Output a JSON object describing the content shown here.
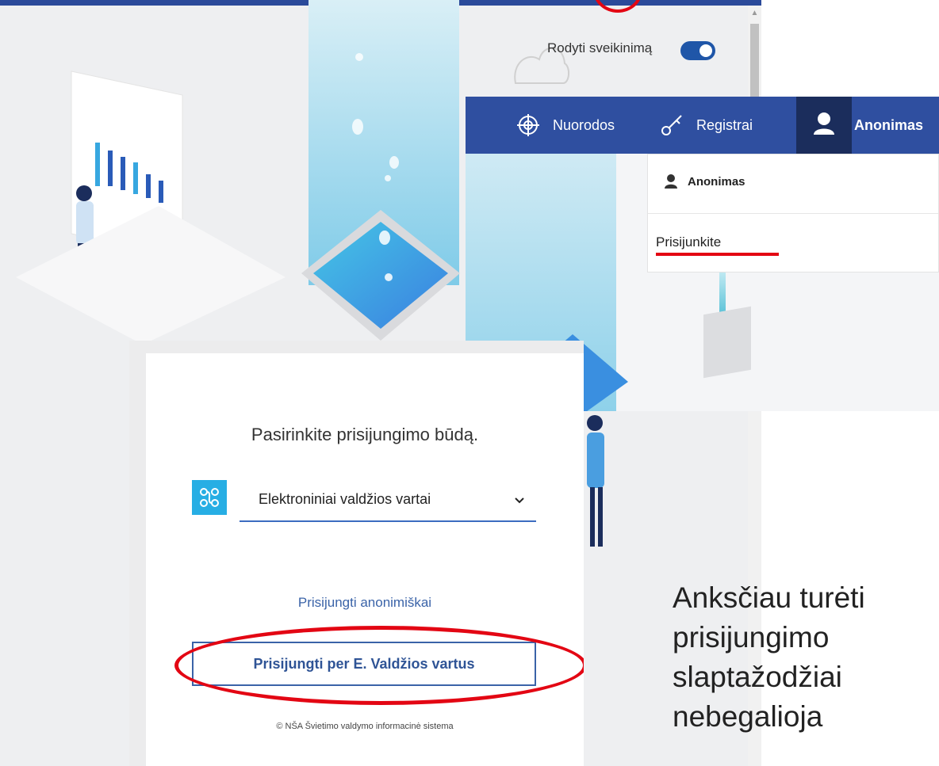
{
  "background": {
    "greeting_toggle_label": "Rodyti sveikinimą",
    "greeting_toggle_on": true
  },
  "nav": {
    "items": [
      {
        "label": "Nuorodos",
        "icon": "crosshair-icon"
      },
      {
        "label": "Registrai",
        "icon": "key-icon"
      },
      {
        "label": "Anonimas",
        "icon": "user-icon"
      }
    ],
    "dropdown": {
      "user_name": "Anonimas",
      "login_label": "Prisijunkite"
    }
  },
  "login": {
    "heading": "Pasirinkite prisijungimo būdą.",
    "method_value": "Elektroniniai valdžios vartai",
    "method_icon": "network-icon",
    "anon_link": "Prisijungti anonimiškai",
    "evartai_button": "Prisijungti per E. Valdžios vartus",
    "footer": "© NŠA Švietimo valdymo informacinė sistema"
  },
  "notice": {
    "lines": [
      "Anksčiau turėti",
      "prisijungimo",
      "slaptažodžiai",
      "nebegalioja"
    ]
  },
  "colors": {
    "nav_blue": "#2f4fa0",
    "highlight_red": "#e30613",
    "link_blue": "#3a63a8",
    "toggle_blue": "#1f56a8"
  }
}
